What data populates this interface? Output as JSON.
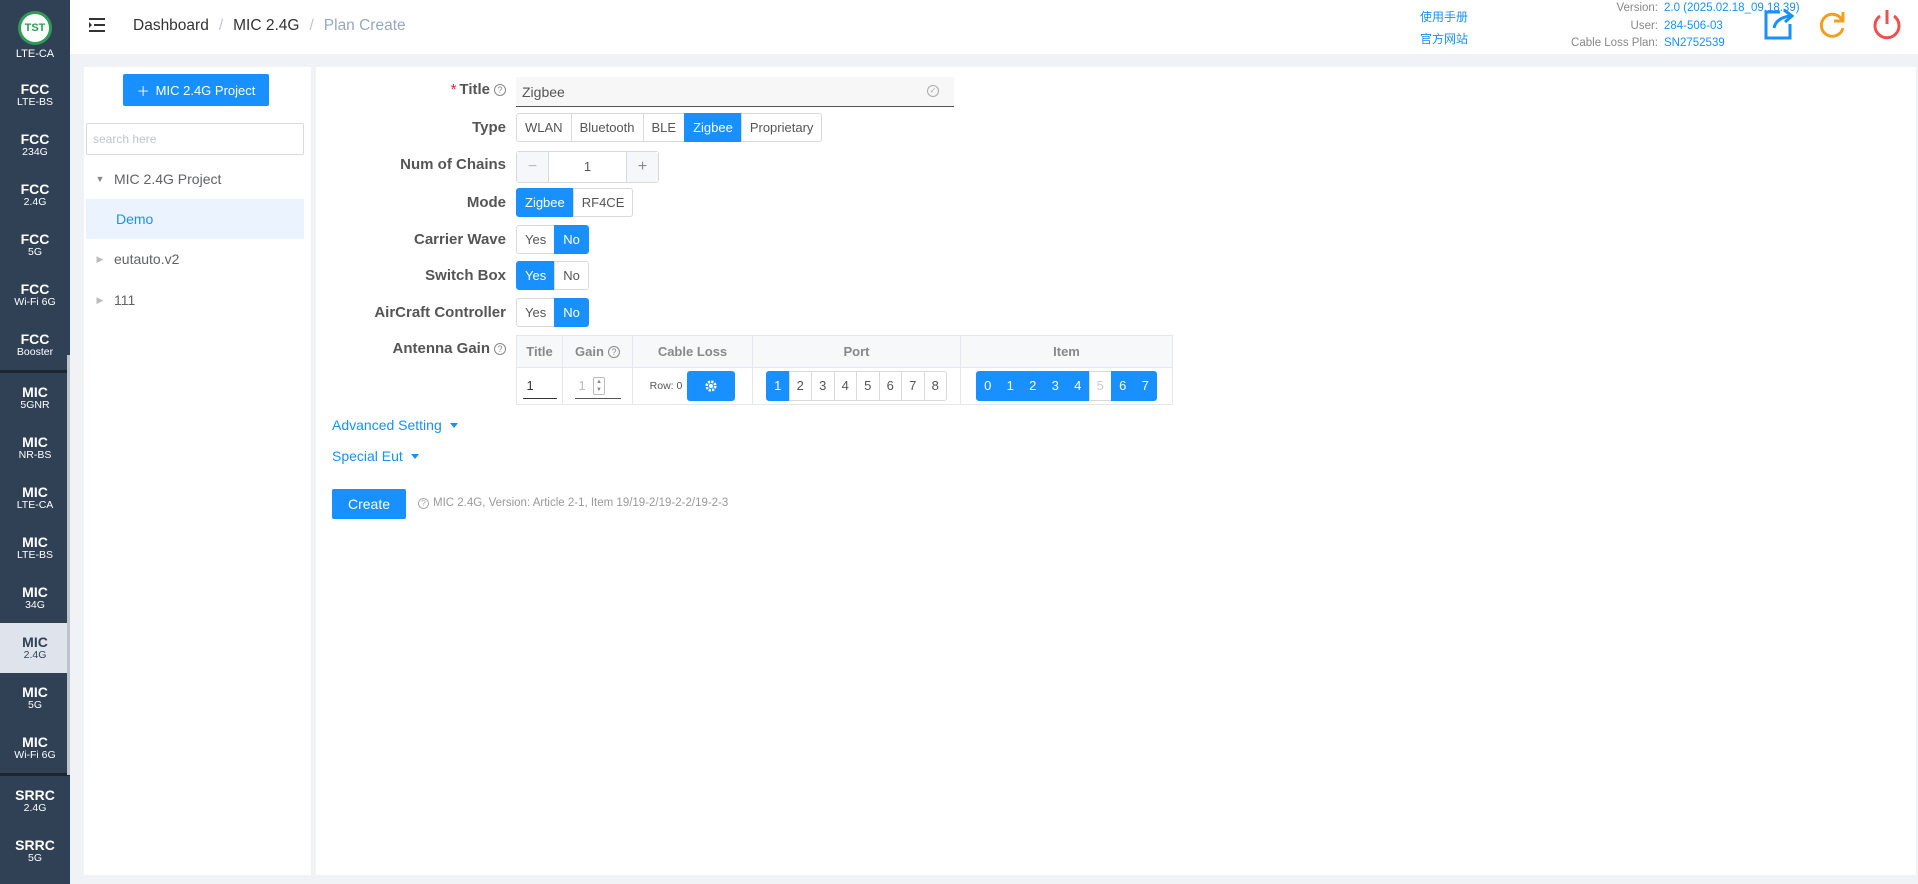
{
  "sidebar": {
    "logo_text": "TST",
    "logo_label": "LTE-CA",
    "items": [
      {
        "t": "FCC",
        "s": "LTE-BS"
      },
      {
        "t": "FCC",
        "s": "234G"
      },
      {
        "t": "FCC",
        "s": "2.4G"
      },
      {
        "t": "FCC",
        "s": "5G"
      },
      {
        "t": "FCC",
        "s": "Wi-Fi 6G"
      },
      {
        "t": "FCC",
        "s": "Booster"
      },
      {
        "t": "MIC",
        "s": "5GNR"
      },
      {
        "t": "MIC",
        "s": "NR-BS"
      },
      {
        "t": "MIC",
        "s": "LTE-CA"
      },
      {
        "t": "MIC",
        "s": "LTE-BS"
      },
      {
        "t": "MIC",
        "s": "34G"
      },
      {
        "t": "MIC",
        "s": "2.4G",
        "active": true
      },
      {
        "t": "MIC",
        "s": "5G"
      },
      {
        "t": "MIC",
        "s": "Wi-Fi 6G"
      },
      {
        "t": "SRRC",
        "s": "2.4G"
      },
      {
        "t": "SRRC",
        "s": "5G"
      }
    ]
  },
  "header": {
    "breadcrumb": [
      "Dashboard",
      "MIC 2.4G",
      "Plan Create"
    ],
    "links": [
      "使用手册",
      "官方网站"
    ],
    "meta": [
      {
        "k": "Version:",
        "v": "2.0 (2025.02.18_09.18.39)"
      },
      {
        "k": "User:",
        "v": "284-506-03"
      },
      {
        "k": "Cable Loss Plan:",
        "v": "SN2752539"
      }
    ]
  },
  "left_panel": {
    "new_button": "MIC 2.4G Project",
    "search_placeholder": "search here",
    "tree": {
      "root": "MIC 2.4G Project",
      "child": "Demo",
      "others": [
        "eutauto.v2",
        "111"
      ]
    }
  },
  "form": {
    "title_label": "Title",
    "title_value": "Zigbee",
    "type_label": "Type",
    "type_options": [
      "WLAN",
      "Bluetooth",
      "BLE",
      "Zigbee",
      "Proprietary"
    ],
    "type_selected": "Zigbee",
    "chains_label": "Num of Chains",
    "chains_value": "1",
    "mode_label": "Mode",
    "mode_options": [
      "Zigbee",
      "RF4CE"
    ],
    "mode_selected": "Zigbee",
    "carrier_label": "Carrier Wave",
    "carrier_options": [
      "Yes",
      "No"
    ],
    "carrier_selected": "No",
    "switch_label": "Switch Box",
    "switch_options": [
      "Yes",
      "No"
    ],
    "switch_selected": "Yes",
    "aircraft_label": "AirCraft Controller",
    "aircraft_options": [
      "Yes",
      "No"
    ],
    "aircraft_selected": "No",
    "antenna_label": "Antenna Gain",
    "antenna_table": {
      "headers": [
        "Title",
        "Gain",
        "Cable Loss",
        "Port",
        "Item"
      ],
      "row": {
        "title": "1",
        "gain_placeholder": "1",
        "cable_loss_row": "Row: 0",
        "ports": [
          "1",
          "2",
          "3",
          "4",
          "5",
          "6",
          "7",
          "8"
        ],
        "ports_selected": [
          "1"
        ],
        "items": [
          "0",
          "1",
          "2",
          "3",
          "4",
          "5",
          "6",
          "7"
        ],
        "items_selected": [
          "0",
          "1",
          "2",
          "3",
          "4",
          "6",
          "7"
        ],
        "items_disabled": [
          "5"
        ]
      }
    },
    "advanced_setting": "Advanced Setting",
    "special_eut": "Special Eut",
    "create_button": "Create",
    "create_hint": "MIC 2.4G, Version: Article 2-1, Item 19/19-2/19-2-2/19-2-3"
  },
  "colors": {
    "accent": "#1890ff",
    "sidebar_bg": "#304156",
    "logo_green": "#2e9b56",
    "export_icon": "#1890ff",
    "refresh_icon": "#f0a020",
    "power_icon": "#f05050"
  }
}
